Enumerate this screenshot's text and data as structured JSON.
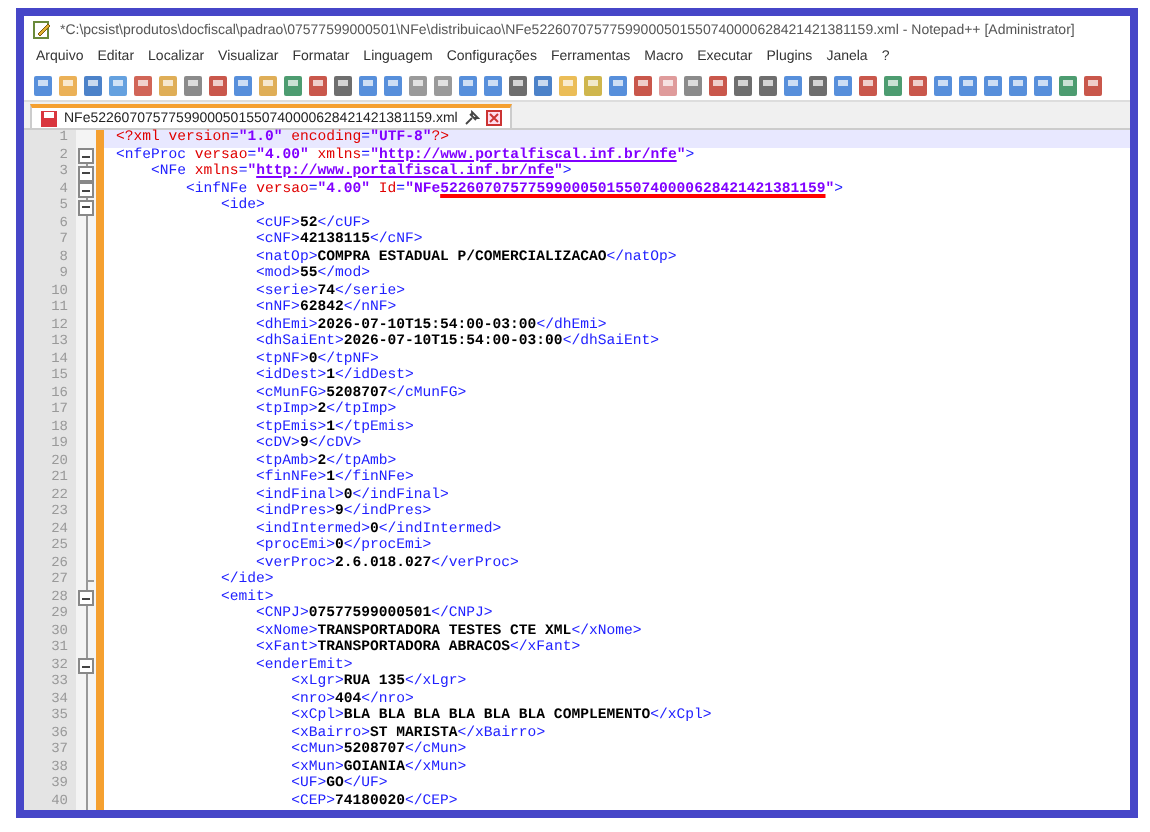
{
  "window": {
    "title": "*C:\\pcsist\\produtos\\docfiscal\\padrao\\07577599000501\\NFe\\distribuicao\\NFe52260707577599000501550740000628421421381159.xml - Notepad++ [Administrator]"
  },
  "menu": [
    "Arquivo",
    "Editar",
    "Localizar",
    "Visualizar",
    "Formatar",
    "Linguagem",
    "Configurações",
    "Ferramentas",
    "Macro",
    "Executar",
    "Plugins",
    "Janela",
    "?"
  ],
  "tabs": [
    {
      "label": "NFe52260707577599000501550740000628421421381159.xml",
      "selected": true,
      "modified": true
    }
  ],
  "editor": {
    "nodes": [
      {
        "line": "1",
        "text": "<?xml version=\"1.0\" encoding=\"UTF-8\"?>",
        "current": true
      },
      {
        "line": "2",
        "text": "<nfeProc versao=\"4.00\" xmlns=\"http://www.portalfiscal.inf.br/nfe\">",
        "expanded": true,
        "children": [
          {
            "line": "3",
            "text": "<NFe xmlns=\"http://www.portalfiscal.inf.br/nfe\">",
            "expanded": true,
            "children": [
              {
                "line": "4",
                "text": [
                  {
                    "text": "<infNFe versao=\"4.00\" Id=\"NFe",
                    "flagged": false
                  },
                  {
                    "text": "52260707577599000501550740000628421421381159",
                    "flagged": true
                  },
                  {
                    "text": "\">",
                    "flagged": false
                  }
                ],
                "expanded": true,
                "children": [
                  {
                    "line": "5",
                    "text": "<ide>",
                    "expanded": true,
                    "close": {
                      "line": "27",
                      "text": "</ide>"
                    },
                    "children": [
                      {
                        "line": "6",
                        "text": "<cUF>52</cUF>"
                      },
                      {
                        "line": "7",
                        "text": "<cNF>42138115</cNF>"
                      },
                      {
                        "line": "8",
                        "text": "<natOp>COMPRA ESTADUAL P/COMERCIALIZACAO</natOp>"
                      },
                      {
                        "line": "9",
                        "text": "<mod>55</mod>"
                      },
                      {
                        "line": "10",
                        "text": "<serie>74</serie>"
                      },
                      {
                        "line": "11",
                        "text": "<nNF>62842</nNF>"
                      },
                      {
                        "line": "12",
                        "text": "<dhEmi>2026-07-10T15:54:00-03:00</dhEmi>"
                      },
                      {
                        "line": "13",
                        "text": "<dhSaiEnt>2026-07-10T15:54:00-03:00</dhSaiEnt>"
                      },
                      {
                        "line": "14",
                        "text": "<tpNF>0</tpNF>"
                      },
                      {
                        "line": "15",
                        "text": "<idDest>1</idDest>"
                      },
                      {
                        "line": "16",
                        "text": "<cMunFG>5208707</cMunFG>"
                      },
                      {
                        "line": "17",
                        "text": "<tpImp>2</tpImp>"
                      },
                      {
                        "line": "18",
                        "text": "<tpEmis>1</tpEmis>"
                      },
                      {
                        "line": "19",
                        "text": "<cDV>9</cDV>"
                      },
                      {
                        "line": "20",
                        "text": "<tpAmb>2</tpAmb>"
                      },
                      {
                        "line": "21",
                        "text": "<finNFe>1</finNFe>"
                      },
                      {
                        "line": "22",
                        "text": "<indFinal>0</indFinal>"
                      },
                      {
                        "line": "23",
                        "text": "<indPres>9</indPres>"
                      },
                      {
                        "line": "24",
                        "text": "<indIntermed>0</indIntermed>"
                      },
                      {
                        "line": "25",
                        "text": "<procEmi>0</procEmi>"
                      },
                      {
                        "line": "26",
                        "text": "<verProc>2.6.018.027</verProc>"
                      }
                    ]
                  },
                  {
                    "line": "28",
                    "text": "<emit>",
                    "expanded": true,
                    "children": [
                      {
                        "line": "29",
                        "text": "<CNPJ>07577599000501</CNPJ>"
                      },
                      {
                        "line": "30",
                        "text": "<xNome>TRANSPORTADORA TESTES CTE XML</xNome>"
                      },
                      {
                        "line": "31",
                        "text": "<xFant>TRANSPORTADORA ABRACOS</xFant>"
                      },
                      {
                        "line": "32",
                        "text": "<enderEmit>",
                        "expanded": true,
                        "children": [
                          {
                            "line": "33",
                            "text": "<xLgr>RUA 135</xLgr>"
                          },
                          {
                            "line": "34",
                            "text": "<nro>404</nro>"
                          },
                          {
                            "line": "35",
                            "text": "<xCpl>BLA BLA BLA BLA BLA BLA COMPLEMENTO</xCpl>"
                          },
                          {
                            "line": "36",
                            "text": "<xBairro>ST MARISTA</xBairro>"
                          },
                          {
                            "line": "37",
                            "text": "<cMun>5208707</cMun>"
                          },
                          {
                            "line": "38",
                            "text": "<xMun>GOIANIA</xMun>"
                          },
                          {
                            "line": "39",
                            "text": "<UF>GO</UF>"
                          },
                          {
                            "line": "40",
                            "text": "<CEP>74180020</CEP>"
                          }
                        ]
                      }
                    ]
                  }
                ]
              }
            ]
          }
        ]
      }
    ]
  }
}
